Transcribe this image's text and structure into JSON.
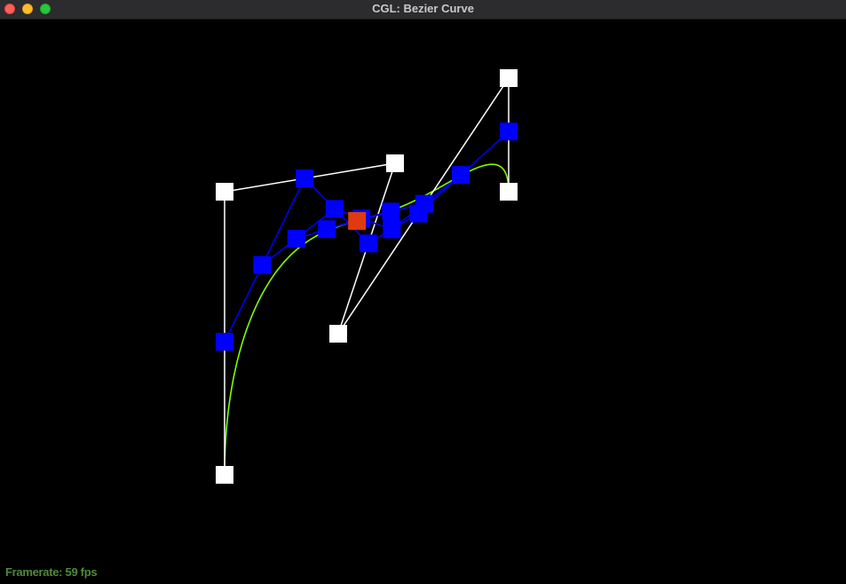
{
  "window": {
    "title": "CGL: Bezier Curve"
  },
  "status": {
    "framerate_label": "Framerate: 59 fps"
  },
  "colors": {
    "titlebar": "#2c2b2e",
    "background": "#000000",
    "control_point": "#ffffff",
    "control_polygon": "#ffffff",
    "intermediate_point": "#0000ff",
    "intermediate_line": "#0000ff",
    "evaluated_point": "#e03a10",
    "curve": "#7fff00",
    "framerate_text": "#4f8a3a"
  }
}
